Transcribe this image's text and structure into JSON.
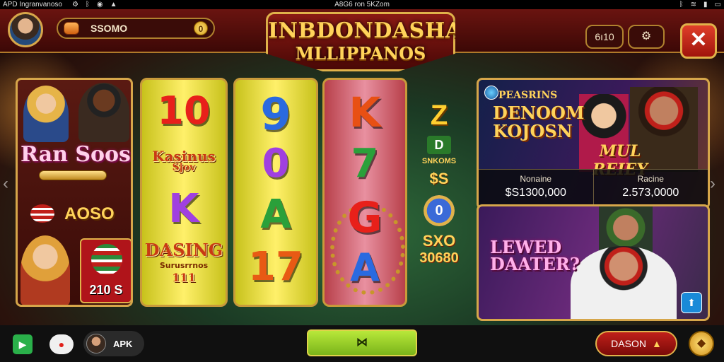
{
  "status_bar": {
    "left": "APD Ingranvanoso",
    "center": "A8G6 ron 5KZom",
    "icons": [
      "settings-icon",
      "bluetooth-icon",
      "eye-icon",
      "triangle-icon"
    ],
    "right_icons": [
      "bluetooth-icon",
      "wifi-icon",
      "signal-icon",
      "battery-icon"
    ]
  },
  "header": {
    "balance": "SSOMO",
    "logo_line1": "INBDONDASHA",
    "logo_line2": "MLLIPPANOS",
    "counter": "6ı10",
    "close_symbol": "✕"
  },
  "left_panel": {
    "title": "Ran Soos",
    "score": "AOSO",
    "tile_value": "210 S"
  },
  "reels": [
    {
      "symbols": [
        "10",
        "Kasinus",
        "Sjov",
        "K",
        "DASING",
        "Surusrrnos",
        "111"
      ]
    },
    {
      "symbols": [
        "9",
        "0",
        "A",
        "17"
      ]
    },
    {
      "symbols": [
        "K",
        "7",
        "G",
        "A"
      ]
    }
  ],
  "middle_column": {
    "top_symbol": "Z",
    "d_symbol": "D",
    "label1": "SNKOMS",
    "label2": "$S",
    "disc": "0",
    "label3": "SXO",
    "label4": "30680"
  },
  "card1": {
    "title_small": "PEASRINS",
    "title_big_1": "DENOOM",
    "title_big_2": "KOJOSN",
    "banner": "MUL REIEY",
    "stats": [
      {
        "label": "Nonaine",
        "value": "$S1300,000"
      },
      {
        "label": "Racine",
        "value": "2.573,0000"
      }
    ]
  },
  "card2": {
    "title_line1": "LEWED",
    "title_line2": "DAATER?",
    "button_symbol": "⬆"
  },
  "bottom_bar": {
    "apk_label": "APK",
    "center_symbol": "⋈",
    "dason_label": "DASON"
  },
  "colors": {
    "accent_gold": "#d6a64a",
    "header_red": "#6a1410",
    "reel_yellow": "#fff06a",
    "reel_pink": "#e890a0"
  }
}
